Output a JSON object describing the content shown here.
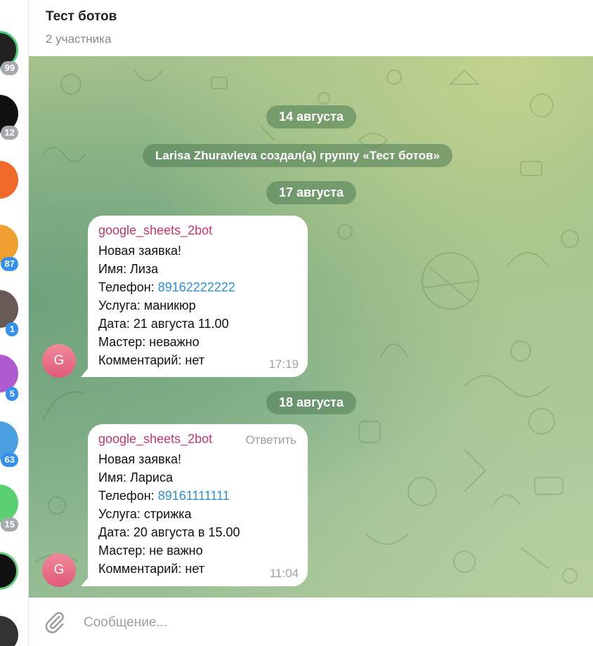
{
  "header": {
    "title": "Тест ботов",
    "subtitle": "2 участника"
  },
  "chat_list": {
    "badges": [
      "99",
      "12",
      "87",
      "1",
      "5",
      "63",
      "15"
    ]
  },
  "messages_area": {
    "date_1": "14 августа",
    "service_text": "Larisa Zhuravleva создал(а) группу «Тест ботов»",
    "date_2": "17 августа",
    "date_3": "18 августа"
  },
  "message_1": {
    "sender": "google_sheets_2bot",
    "avatar_letter": "G",
    "line_1": "Новая заявка!",
    "line_2": "Имя: Лиза",
    "phone_label": "Телефон: ",
    "phone_value": "89162222222",
    "line_4": "Услуга: маникюр",
    "line_5": "Дата: 21 августа 11.00",
    "line_6": "Мастер: неважно",
    "line_7": "Комментарий: нет",
    "time": "17:19"
  },
  "message_2": {
    "sender": "google_sheets_2bot",
    "reply_label": "Ответить",
    "avatar_letter": "G",
    "line_1": "Новая заявка!",
    "line_2": "Имя: Лариса",
    "phone_label": "Телефон: ",
    "phone_value": "89161111111",
    "line_4": "Услуга: стрижка",
    "line_5": "Дата: 20 августа в 15.00",
    "line_6": "Мастер: не важно",
    "line_7": "Комментарий: нет",
    "time": "11:04"
  },
  "composer": {
    "placeholder": "Сообщение..."
  },
  "colors": {
    "accent": "#3390ec",
    "sender_name": "#c4366b",
    "link": "#2f8fd9",
    "badge_gray": "#a6a9ad"
  },
  "icons": [
    "paperclip-icon"
  ]
}
